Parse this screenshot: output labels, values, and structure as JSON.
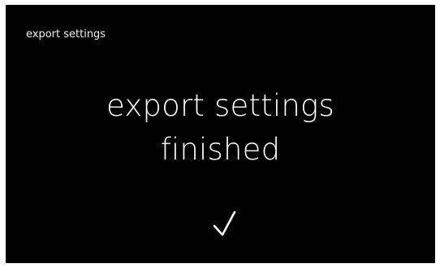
{
  "header": {
    "title": "export settings"
  },
  "status": {
    "line1": "export settings",
    "line2": "finished",
    "icon": "check-icon"
  },
  "colors": {
    "background": "#000000",
    "text": "#ffffff",
    "frame": "#ffffff"
  }
}
